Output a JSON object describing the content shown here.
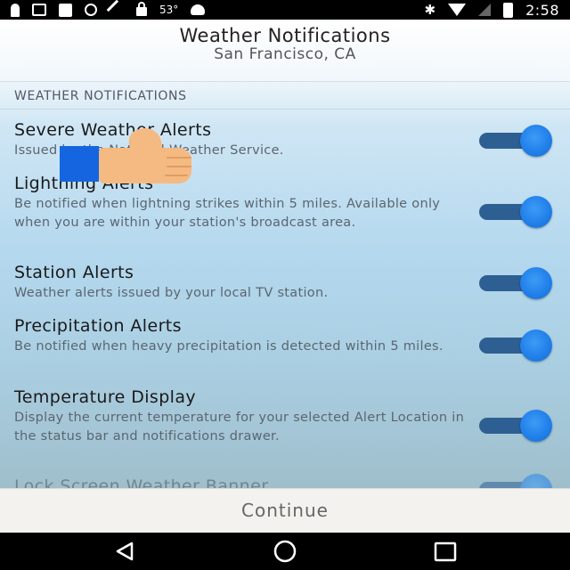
{
  "status_bar": {
    "temperature": "53°",
    "time": "2:58",
    "icons": [
      "person-icon",
      "message-icon",
      "facebook-icon",
      "info-icon",
      "wrench-icon",
      "lock-icon",
      "android-icon",
      "bluetooth-icon",
      "wifi-icon",
      "signal-icon",
      "battery-icon"
    ]
  },
  "header": {
    "title": "Weather Notifications",
    "subtitle": "San Francisco, CA"
  },
  "section": {
    "label": "WEATHER NOTIFICATIONS"
  },
  "items": [
    {
      "title": "Severe Weather Alerts",
      "description": "Issued by the National Weather Service.",
      "enabled": true
    },
    {
      "title": "Lightning Alerts",
      "description": "Be notified when lightning strikes within 5 miles. Available only when you are within your station's broadcast area.",
      "enabled": true
    },
    {
      "title": "Station Alerts",
      "description": "Weather alerts issued by your local TV station.",
      "enabled": true
    },
    {
      "title": "Precipitation Alerts",
      "description": "Be notified when heavy precipitation is detected within 5 miles.",
      "enabled": true
    },
    {
      "title": "Temperature Display",
      "description": "Display the current temperature for your selected Alert Location in the status bar and notifications drawer.",
      "enabled": true
    },
    {
      "title": "Lock Screen Weather Banner",
      "description": "",
      "enabled": true
    }
  ],
  "footer": {
    "continue_label": "Continue"
  },
  "colors": {
    "toggle_track": "#2e5f93",
    "toggle_thumb": "#1f7ee8",
    "thumbs_cuff": "#1565e0",
    "thumbs_hand": "#f5b982"
  },
  "nav": {
    "buttons": [
      "back-icon",
      "home-icon",
      "recents-icon"
    ]
  }
}
